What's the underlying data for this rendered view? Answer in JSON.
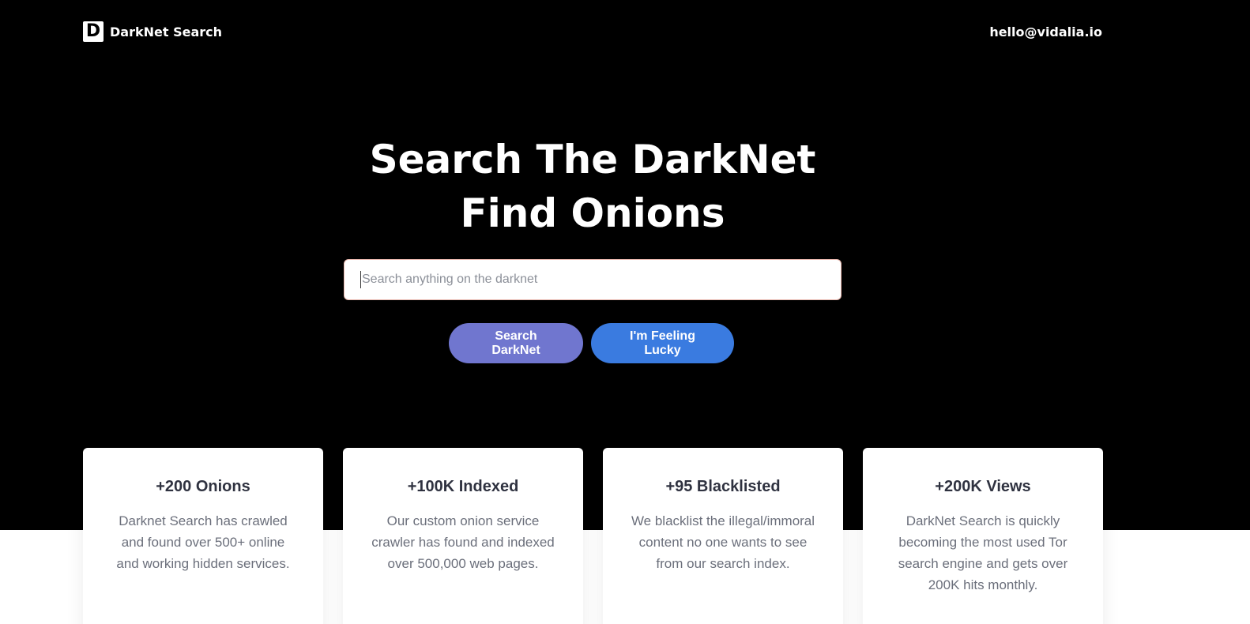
{
  "nav": {
    "logo_letter": "D",
    "brand": "DarkNet Search",
    "contact_email": "hello@vidalia.io"
  },
  "hero": {
    "title_line1": "Search The DarkNet",
    "title_line2": "Find Onions"
  },
  "search": {
    "placeholder": "Search anything on the darknet",
    "value": ""
  },
  "buttons": {
    "search_label": "Search DarkNet",
    "lucky_label": "I'm Feeling Lucky"
  },
  "stats": [
    {
      "title": "+200 Onions",
      "text": "Darknet Search has crawled and found over 500+ online and working hidden services."
    },
    {
      "title": "+100K Indexed",
      "text": "Our custom onion service crawler has found and indexed over 500,000 web pages."
    },
    {
      "title": "+95 Blacklisted",
      "text": "We blacklist the illegal/immoral content no one wants to see from our search index."
    },
    {
      "title": "+200K Views",
      "text": "DarkNet Search is quickly becoming the most used Tor search engine and gets over 200K hits monthly."
    }
  ],
  "colors": {
    "hero_background": "#000000",
    "search_button": "#7076cf",
    "lucky_button": "#3a7be0"
  }
}
